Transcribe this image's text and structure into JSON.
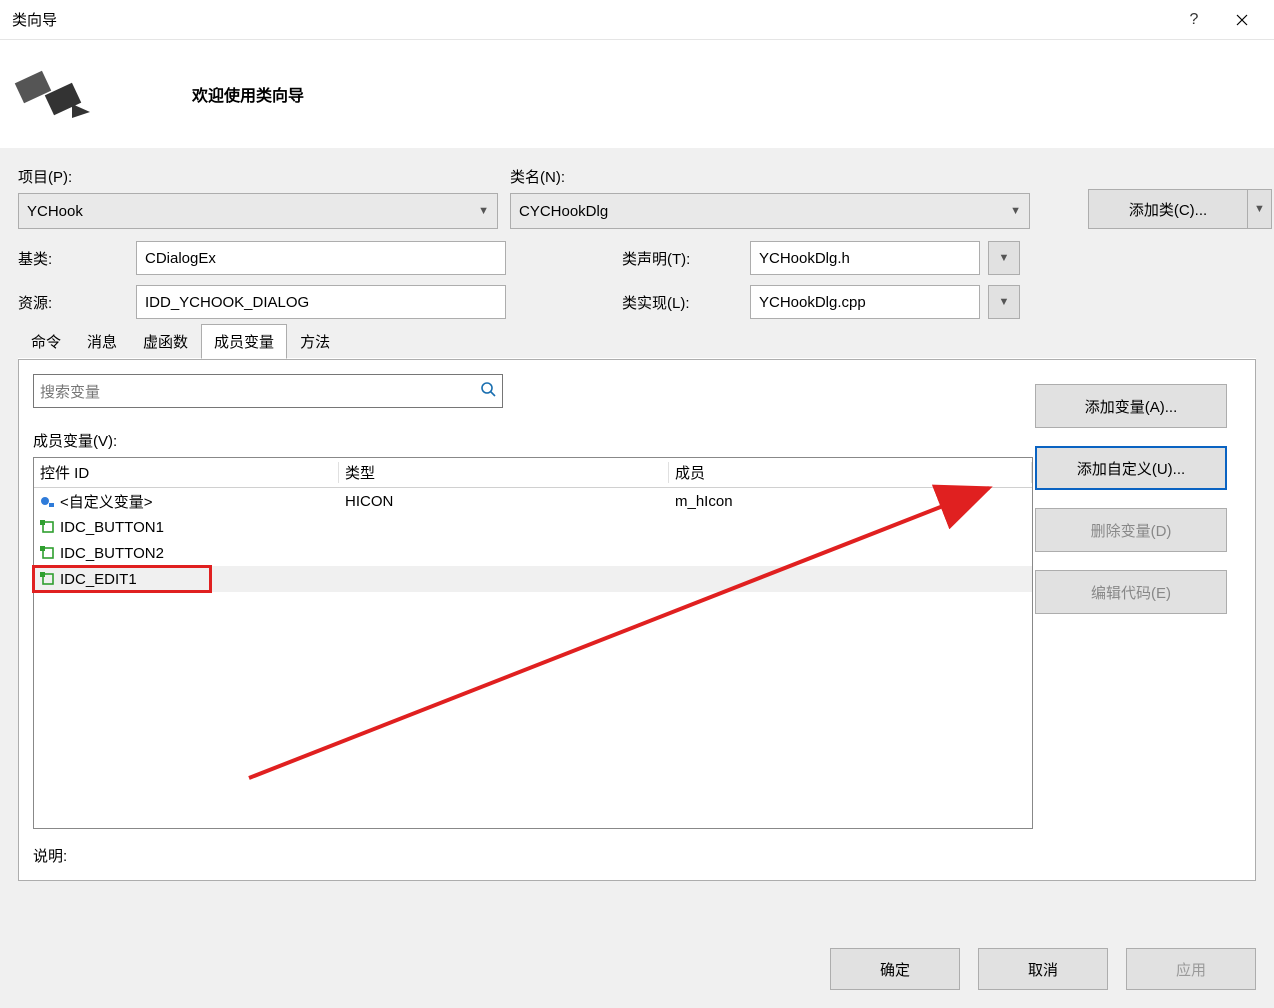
{
  "title": "类向导",
  "welcome": "欢迎使用类向导",
  "labels": {
    "project": "项目(P):",
    "className": "类名(N):",
    "baseClass": "基类:",
    "resource": "资源:",
    "declaration": "类声明(T):",
    "implementation": "类实现(L):",
    "addClass": "添加类(C)...",
    "searchPlaceholder": "搜索变量",
    "memberVars": "成员变量(V):",
    "description": "说明:"
  },
  "fields": {
    "project": "YCHook",
    "className": "CYCHookDlg",
    "baseClass": "CDialogEx",
    "resource": "IDD_YCHOOK_DIALOG",
    "declaration": "YCHookDlg.h",
    "implementation": "YCHookDlg.cpp"
  },
  "tabs": [
    "命令",
    "消息",
    "虚函数",
    "成员变量",
    "方法"
  ],
  "activeTab": 3,
  "tableHeaders": {
    "id": "控件 ID",
    "type": "类型",
    "member": "成员"
  },
  "rows": [
    {
      "id": "<自定义变量>",
      "type": "HICON",
      "member": "m_hIcon",
      "iconKind": "custom"
    },
    {
      "id": "IDC_BUTTON1",
      "type": "",
      "member": "",
      "iconKind": "ctrl"
    },
    {
      "id": "IDC_BUTTON2",
      "type": "",
      "member": "",
      "iconKind": "ctrl"
    },
    {
      "id": "IDC_EDIT1",
      "type": "",
      "member": "",
      "iconKind": "ctrl",
      "selected": true
    }
  ],
  "sideButtons": {
    "addVar": "添加变量(A)...",
    "addCustom": "添加自定义(U)...",
    "deleteVar": "删除变量(D)",
    "editCode": "编辑代码(E)"
  },
  "footer": {
    "ok": "确定",
    "cancel": "取消",
    "apply": "应用"
  }
}
